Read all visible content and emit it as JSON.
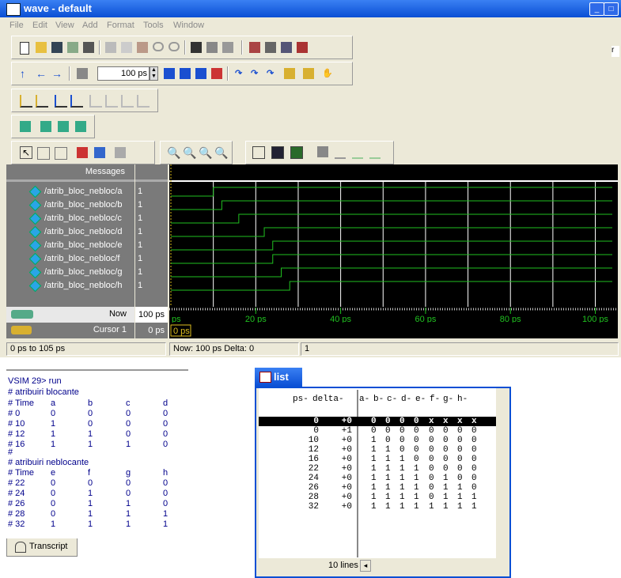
{
  "wave": {
    "title": "wave - default",
    "menu": [
      "File",
      "Edit",
      "View",
      "Add",
      "Format",
      "Tools",
      "Window"
    ],
    "run_length": "100 ps",
    "messages_header": "Messages",
    "signals": [
      {
        "name": "/atrib_bloc_nebloc/a",
        "value": "1",
        "rise_ps": 10
      },
      {
        "name": "/atrib_bloc_nebloc/b",
        "value": "1",
        "rise_ps": 12
      },
      {
        "name": "/atrib_bloc_nebloc/c",
        "value": "1",
        "rise_ps": 16
      },
      {
        "name": "/atrib_bloc_nebloc/d",
        "value": "1",
        "rise_ps": 22
      },
      {
        "name": "/atrib_bloc_nebloc/e",
        "value": "1",
        "rise_ps": 24
      },
      {
        "name": "/atrib_bloc_nebloc/f",
        "value": "1",
        "rise_ps": 24
      },
      {
        "name": "/atrib_bloc_nebloc/g",
        "value": "1",
        "rise_ps": 26
      },
      {
        "name": "/atrib_bloc_nebloc/h",
        "value": "1",
        "rise_ps": 28
      }
    ],
    "now_label": "Now",
    "now_value": "100 ps",
    "cursor_label": "Cursor 1",
    "cursor_value": "0 ps",
    "cursor_marker": "0 ps",
    "axis_start_label": "ps",
    "axis_ticks": [
      "20 ps",
      "40 ps",
      "60 ps",
      "80 ps",
      "100 ps"
    ],
    "axis_tick_values": [
      20,
      40,
      60,
      80,
      100
    ],
    "axis_range": [
      0,
      104
    ],
    "status": {
      "range": "0 ps to 105 ps",
      "now_delta": "Now: 100 ps  Delta: 0",
      "count": "1"
    },
    "colors": {
      "wave": "#20c020",
      "grid": "#ffffff",
      "now_bar": "#c0c0c0",
      "cursor": "#e0c020"
    }
  },
  "transcript": {
    "prompt": "VSIM 29> run",
    "section1": "# atribuiri blocante",
    "header1": [
      "# Time",
      "a",
      "b",
      "c",
      "d"
    ],
    "rows1": [
      [
        "# 0",
        "0",
        "0",
        "0",
        "0"
      ],
      [
        "# 10",
        "1",
        "0",
        "0",
        "0"
      ],
      [
        "# 12",
        "1",
        "1",
        "0",
        "0"
      ],
      [
        "# 16",
        "1",
        "1",
        "1",
        "0"
      ]
    ],
    "blank": "#",
    "section2": "# atribuiri neblocante",
    "header2": [
      "# Time",
      "e",
      "f",
      "g",
      "h"
    ],
    "rows2": [
      [
        "# 22",
        "0",
        "0",
        "0",
        "0"
      ],
      [
        "# 24",
        "0",
        "1",
        "0",
        "0"
      ],
      [
        "# 26",
        "0",
        "1",
        "1",
        "0"
      ],
      [
        "# 28",
        "0",
        "1",
        "1",
        "1"
      ],
      [
        "# 32",
        "1",
        "1",
        "1",
        "1"
      ]
    ],
    "tab_label": "Transcript"
  },
  "list": {
    "title": "list",
    "headers": [
      "ps",
      "delta",
      "a",
      "b",
      "c",
      "d",
      "e",
      "f",
      "g",
      "h"
    ],
    "rows": [
      [
        "0",
        "+0",
        "0",
        "0",
        "0",
        "0",
        "x",
        "x",
        "x",
        "x"
      ],
      [
        "0",
        "+1",
        "0",
        "0",
        "0",
        "0",
        "0",
        "0",
        "0",
        "0"
      ],
      [
        "10",
        "+0",
        "1",
        "0",
        "0",
        "0",
        "0",
        "0",
        "0",
        "0"
      ],
      [
        "12",
        "+0",
        "1",
        "1",
        "0",
        "0",
        "0",
        "0",
        "0",
        "0"
      ],
      [
        "16",
        "+0",
        "1",
        "1",
        "1",
        "0",
        "0",
        "0",
        "0",
        "0"
      ],
      [
        "22",
        "+0",
        "1",
        "1",
        "1",
        "1",
        "0",
        "0",
        "0",
        "0"
      ],
      [
        "24",
        "+0",
        "1",
        "1",
        "1",
        "1",
        "0",
        "1",
        "0",
        "0"
      ],
      [
        "26",
        "+0",
        "1",
        "1",
        "1",
        "1",
        "0",
        "1",
        "1",
        "0"
      ],
      [
        "28",
        "+0",
        "1",
        "1",
        "1",
        "1",
        "0",
        "1",
        "1",
        "1"
      ],
      [
        "32",
        "+0",
        "1",
        "1",
        "1",
        "1",
        "1",
        "1",
        "1",
        "1"
      ]
    ],
    "status": "10 lines"
  }
}
